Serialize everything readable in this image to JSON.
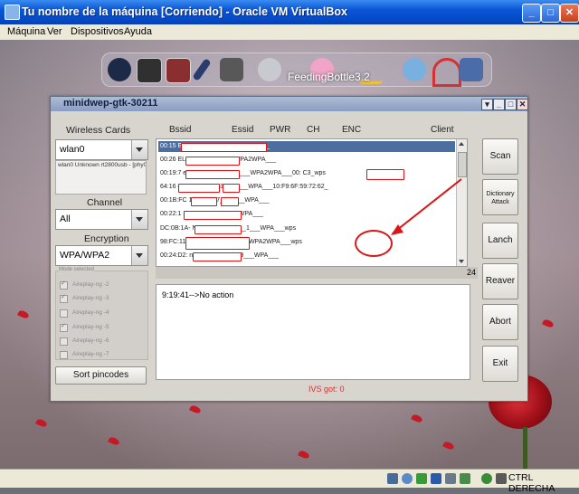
{
  "host": {
    "window_title": "Tu nombre de la máquina [Corriendo] - Oracle VM VirtualBox",
    "menu": [
      "Máquina",
      "Ver",
      "Dispositivos",
      "Ayuda"
    ],
    "controls": {
      "minimize": "_",
      "maximize": "□",
      "close": "✕"
    },
    "status_text": "CTRL DERECHA"
  },
  "desktop": {
    "dock_label": "FeedingBottle3.2",
    "dock_icons": [
      "power-icon",
      "terminal-icon",
      "window-icon",
      "brush-icon",
      "settings-icon",
      "harddisk-icon",
      "feedingbottle-icon",
      "tools-icon",
      "network-icon",
      "wireless-icon",
      "xfe-icon"
    ]
  },
  "app": {
    "title": "minidwep-gtk-30211",
    "controls": {
      "menu": "▾",
      "minimize": "_",
      "maximize": "□",
      "close": "✕"
    },
    "wireless_cards_label": "Wireless Cards",
    "card_value": "wlan0",
    "card_info": "wlan0 Unknown rt2800usb - [phy0]",
    "channel_label": "Channel",
    "channel_value": "All",
    "encryption_label": "Encryption",
    "encryption_value": "WPA/WPA2",
    "mode_caption": "Mode selected",
    "mode_options": [
      {
        "label": "Aireplay-ng -2",
        "checked": true
      },
      {
        "label": "Aireplay-ng -3",
        "checked": true
      },
      {
        "label": "Aireplay-ng -4",
        "checked": false
      },
      {
        "label": "Aireplay-ng -5",
        "checked": true
      },
      {
        "label": "Aireplay-ng -6",
        "checked": false
      },
      {
        "label": "Aireplay-ng -7",
        "checked": false
      }
    ],
    "sort_button": "Sort pincodes",
    "columns": [
      "Bssid",
      "Essid",
      "PWR",
      "CH",
      "ENC",
      "Client"
    ],
    "networks": [
      "00:15                              Ext__-77___3___WPA2WPA___",
      "00:26                          ELA___-79___3___WPA2WPA___",
      "00:19:7                          e-5724___-113___6___WPA2WPA___00:                  C3_wps",
      "64:16                                    oneDF70___-93___6___WPA___10:F9:6F:59:72:62_",
      "00:1B:FC                                  1_6D__-77___1___WPA___",
      "00:22:1                                   1_2E__-77___1___WPA___",
      "DC:0B:1A-                                N_EB05___-76___1___WPA___wps",
      "98:FC:11                                  allado___-76___1___WPA2WPA___wps",
      "00:24:D2:                                  necasa___-75___3___WPA___"
    ],
    "network_count": "24",
    "log_line": "9:19:41-->No action",
    "ivs_text": "IVS got: 0",
    "buttons": {
      "scan": "Scan",
      "dictionary": "Dictionary Attack",
      "launch": "Lanch",
      "reaver": "Reaver",
      "abort": "Abort",
      "exit": "Exit"
    }
  }
}
